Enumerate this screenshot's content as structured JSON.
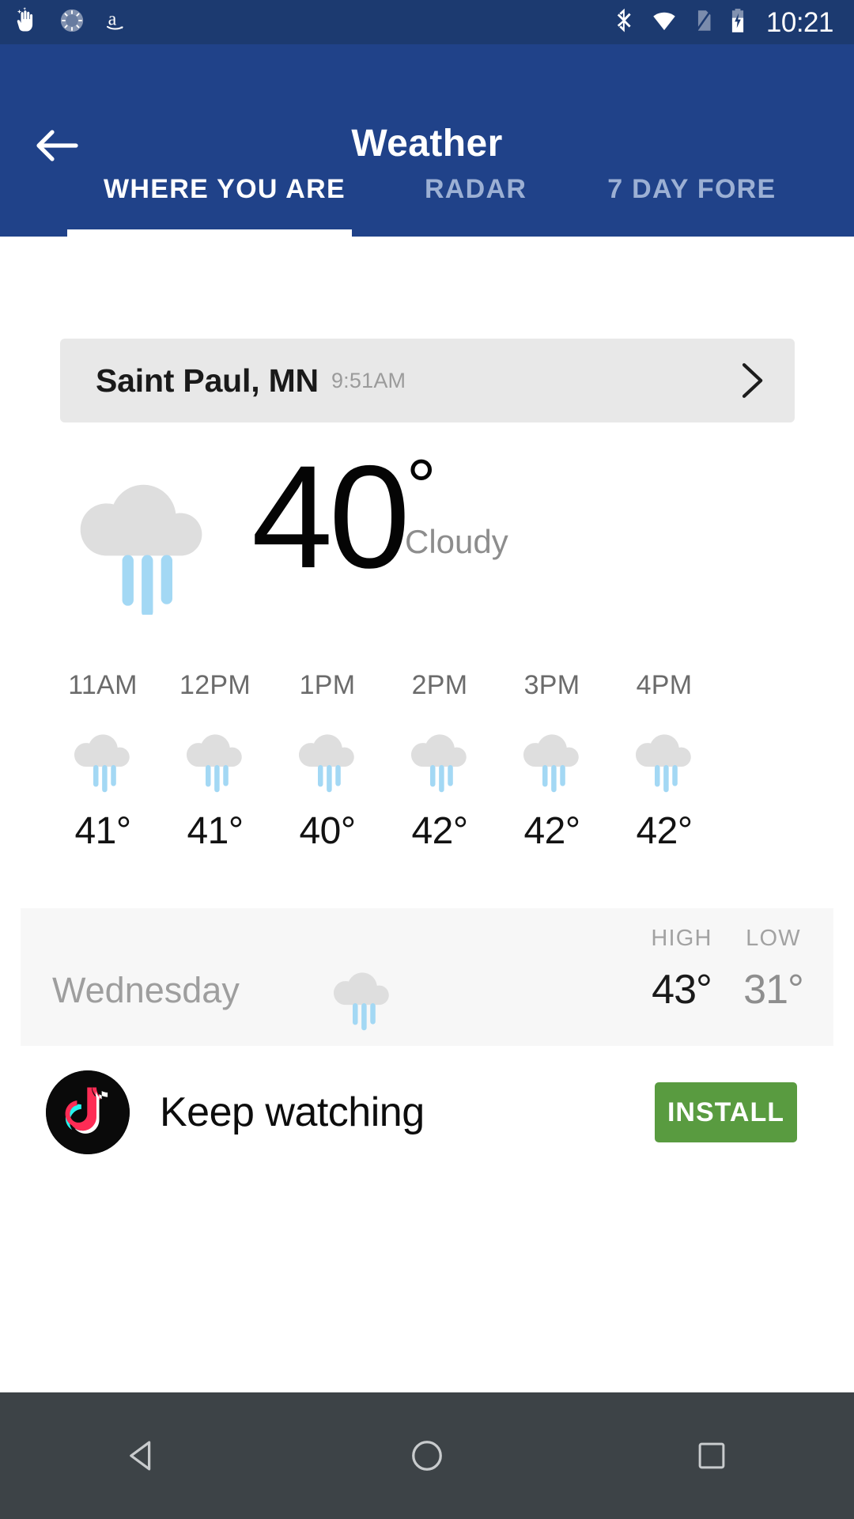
{
  "status_bar": {
    "time": "10:21",
    "left_icons": [
      "sparkle-hand-icon",
      "spinner-icon",
      "amazon-icon"
    ],
    "right_icons": [
      "bluetooth-icon",
      "wifi-icon",
      "sim-card-icon",
      "battery-charging-icon"
    ],
    "background": "#1c3a70"
  },
  "app_bar": {
    "title": "Weather",
    "back_icon": "back-arrow-icon",
    "background": "#204289",
    "tabs": [
      {
        "label": "WHERE YOU ARE",
        "active": true
      },
      {
        "label": "RADAR",
        "active": false
      },
      {
        "label": "7 DAY FORE",
        "active": false
      }
    ]
  },
  "location": {
    "name": "Saint Paul, MN",
    "time": "9:51AM",
    "chevron_icon": "chevron-right-icon"
  },
  "current": {
    "temperature": "40",
    "degree": "°",
    "condition": "Cloudy",
    "icon": "rain-cloud-icon"
  },
  "hourly": [
    {
      "time": "11AM",
      "temp": "41°",
      "icon": "rain-cloud-icon"
    },
    {
      "time": "12PM",
      "temp": "41°",
      "icon": "rain-cloud-icon"
    },
    {
      "time": "1PM",
      "temp": "40°",
      "icon": "rain-cloud-icon"
    },
    {
      "time": "2PM",
      "temp": "42°",
      "icon": "rain-cloud-icon"
    },
    {
      "time": "3PM",
      "temp": "42°",
      "icon": "rain-cloud-icon"
    },
    {
      "time": "4PM",
      "temp": "42°",
      "icon": "rain-cloud-icon"
    }
  ],
  "daily": {
    "high_label": "HIGH",
    "low_label": "LOW",
    "day": "Wednesday",
    "high": "43°",
    "low": "31°",
    "icon": "rain-cloud-icon"
  },
  "ad": {
    "logo": "tiktok-icon",
    "text": "Keep watching",
    "install_label": "INSTALL",
    "install_color": "#599b40"
  },
  "nav_bar": {
    "back": "nav-back-icon",
    "home": "nav-home-icon",
    "recents": "nav-recents-icon",
    "background": "#3d4347"
  },
  "colors": {
    "cloud_gray": "#dedede",
    "rain_blue": "#a3d8f4",
    "accent_blue": "#204289"
  }
}
